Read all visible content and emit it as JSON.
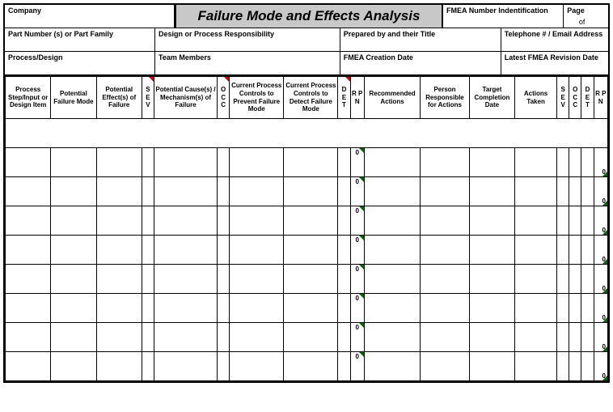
{
  "header": {
    "company": "Company",
    "title": "Failure Mode and Effects Analysis",
    "fmea_number": "FMEA Number Indentification",
    "page": "Page",
    "of": "of",
    "part_number": "Part Number (s) or Part Family",
    "design_resp": "Design or Process Responsibility",
    "prepared_by": "Prepared by and their Title",
    "telephone": "Telephone # / Email Address",
    "process_design": "Process/Design",
    "team_members": "Team Members",
    "creation_date": "FMEA Creation Date",
    "revision_date": "Latest FMEA Revision Date"
  },
  "columns": {
    "c0": "Process Step/Input or Design Item",
    "c1": "Potential Failure Mode",
    "c2": "Potential Effect(s) of Failure",
    "c3": "S E V",
    "c4": "Potential Cause(s) / Mechanism(s) of Failure",
    "c5": "O C C",
    "c6": "Current Process Controls to Prevent Failure Mode",
    "c7": "Current Process Controls to Detect Failure Mode",
    "c8": "D E T",
    "c9": "R P N",
    "c10": "Recommended Actions",
    "c11": "Person Responsible for Actions",
    "c12": "Target Completion Date",
    "c13": "Actions Taken",
    "c14": "S E V",
    "c15": "O C C",
    "c16": "D E T",
    "c17": "R P N"
  },
  "rows": [
    {
      "rpn1": "0",
      "rpn2": "0"
    },
    {
      "rpn1": "0",
      "rpn2": "0"
    },
    {
      "rpn1": "0",
      "rpn2": "0"
    },
    {
      "rpn1": "0",
      "rpn2": "0"
    },
    {
      "rpn1": "0",
      "rpn2": "0"
    },
    {
      "rpn1": "0",
      "rpn2": "0"
    },
    {
      "rpn1": "0",
      "rpn2": "0"
    },
    {
      "rpn1": "0",
      "rpn2": "0"
    }
  ]
}
